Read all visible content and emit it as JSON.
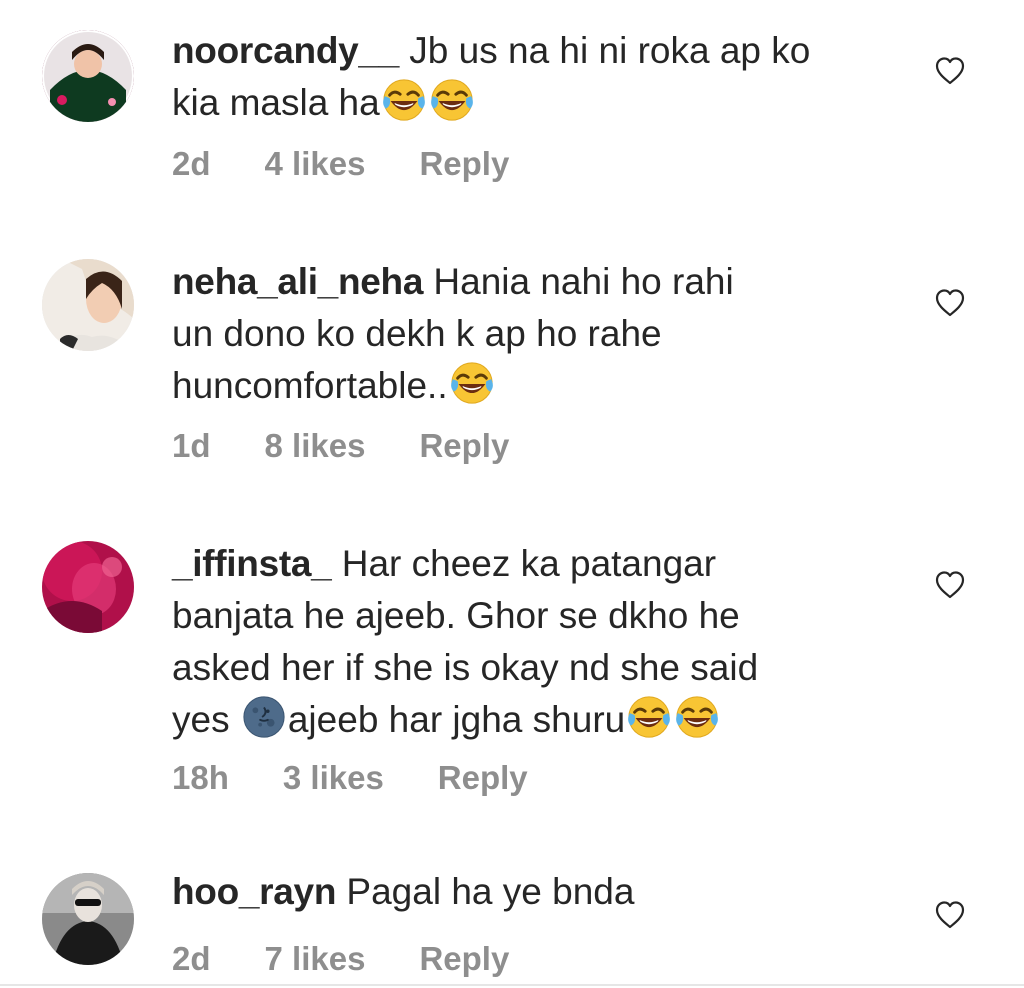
{
  "comments": [
    {
      "username": "noorcandy__",
      "text_lines": [
        "Jb us na hi ni roka ap ko",
        "kia masla ha"
      ],
      "emojis_after": [
        "face-with-tears-of-joy",
        "face-with-tears-of-joy"
      ],
      "time": "2d",
      "likes": "4 likes",
      "reply": "Reply"
    },
    {
      "username": "neha_ali_neha",
      "text_lines": [
        "Hania nahi ho rahi",
        "un dono ko dekh k ap ho rahe",
        "huncomfortable.."
      ],
      "emojis_after": [
        "face-with-tears-of-joy"
      ],
      "time": "1d",
      "likes": "8 likes",
      "reply": "Reply"
    },
    {
      "username": "_iffinsta_",
      "text_lines": [
        "Har cheez ka patangar",
        "banjata he ajeeb. Ghor se dkho he",
        "asked her if she is okay nd she said",
        "yes",
        "ajeeb har jgha shuru"
      ],
      "emojis_after": [
        "face-with-tears-of-joy",
        "face-with-tears-of-joy"
      ],
      "inline_emoji": "new-moon-face",
      "time": "18h",
      "likes": "3 likes",
      "reply": "Reply"
    },
    {
      "username": "hoo_rayn",
      "text_lines": [
        "Pagal ha ye bnda"
      ],
      "time": "2d",
      "likes": "7 likes",
      "reply": "Reply"
    }
  ],
  "colors": {
    "text": "#262626",
    "meta": "#8e8e8e",
    "background": "#ffffff"
  },
  "icons": {
    "like": "heart-outline-icon",
    "emoji_laugh": "face-with-tears-of-joy",
    "emoji_moon": "new-moon-face"
  }
}
